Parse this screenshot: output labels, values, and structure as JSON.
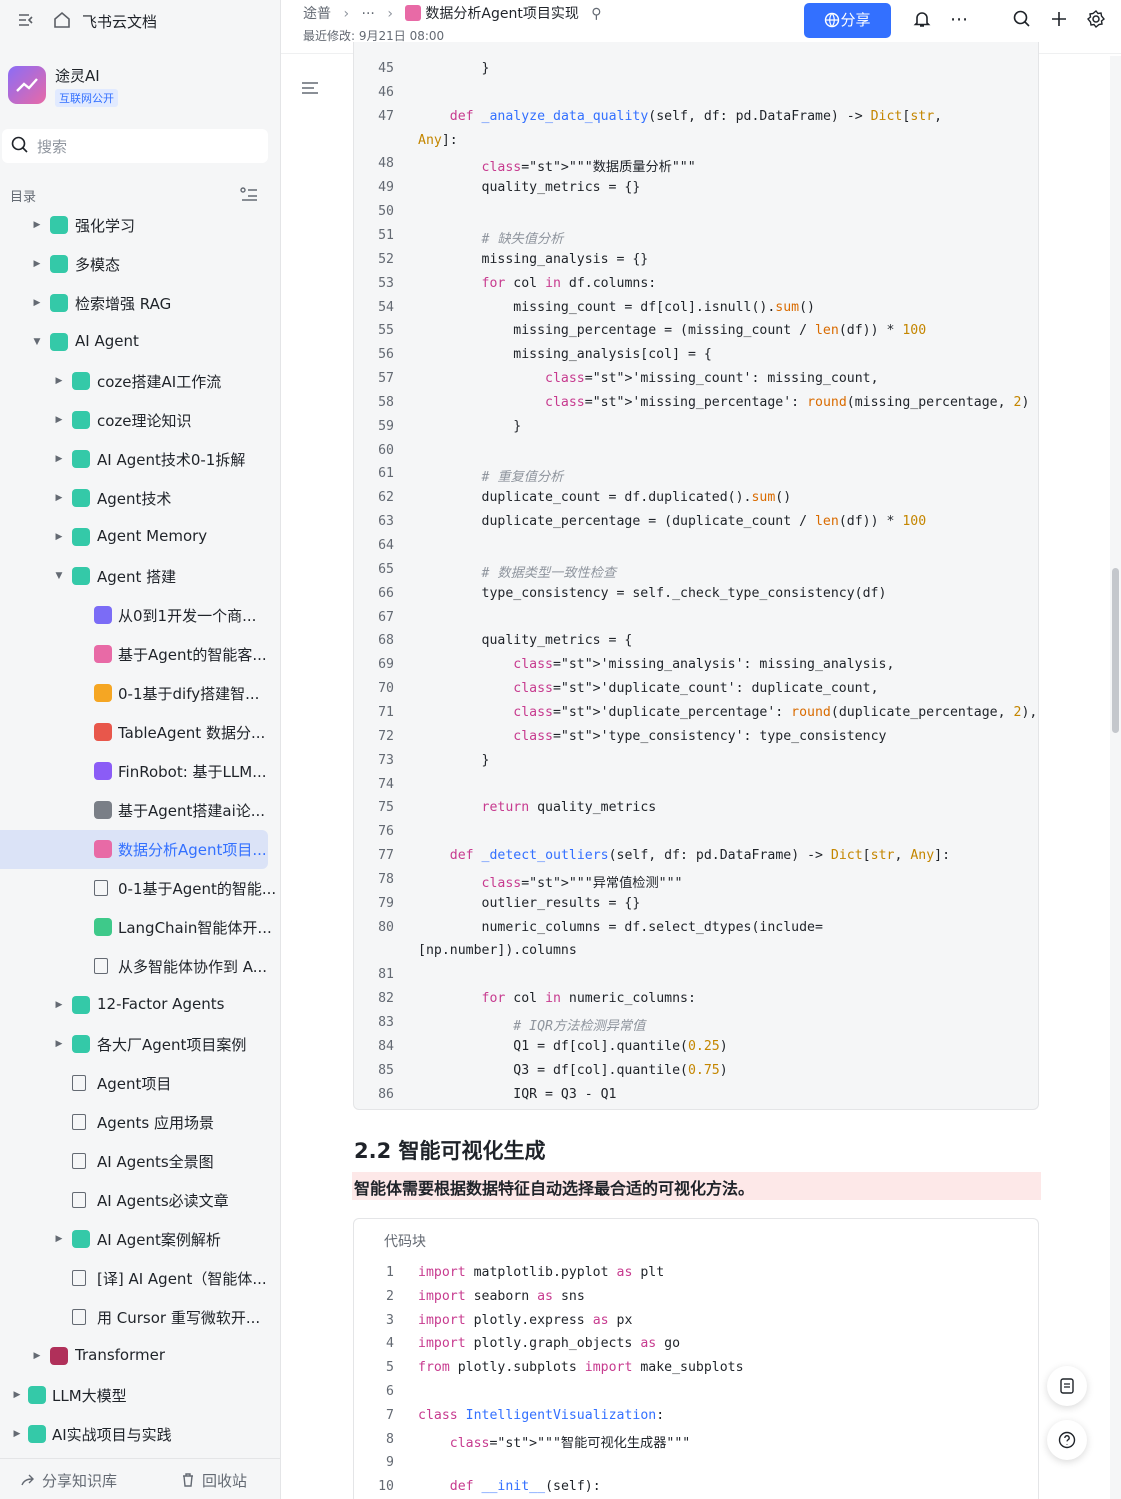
{
  "sidebar": {
    "brand": "飞书云文档",
    "space_name": "途灵AI",
    "space_tag": "互联网公开",
    "search_placeholder": "搜索",
    "toc_label": "目录",
    "items": [
      {
        "label": "强化学习",
        "level": 1,
        "caret": "right",
        "icon": "doc-green-icon"
      },
      {
        "label": "多模态",
        "level": 1,
        "caret": "right",
        "icon": "doc-green-icon"
      },
      {
        "label": "检索增强 RAG",
        "level": 1,
        "caret": "right",
        "icon": "doc-green-icon"
      },
      {
        "label": "AI Agent",
        "level": 1,
        "caret": "down",
        "icon": "doc-green-icon"
      },
      {
        "label": "coze搭建AI工作流",
        "level": 2,
        "caret": "right",
        "icon": "doc-green-icon"
      },
      {
        "label": "coze理论知识",
        "level": 2,
        "caret": "right",
        "icon": "doc-green-icon"
      },
      {
        "label": "AI Agent技术0-1拆解",
        "level": 2,
        "caret": "right",
        "icon": "doc-green-icon"
      },
      {
        "label": "Agent技术",
        "level": 2,
        "caret": "right",
        "icon": "doc-green-icon"
      },
      {
        "label": "Agent Memory",
        "level": 2,
        "caret": "right",
        "icon": "doc-green-icon"
      },
      {
        "label": "Agent 搭建",
        "level": 2,
        "caret": "down",
        "icon": "doc-green-icon"
      },
      {
        "label": "从0到1开发一个商...",
        "level": 3,
        "caret": "",
        "icon": "clock-purple-icon"
      },
      {
        "label": "基于Agent的智能客...",
        "level": 3,
        "caret": "",
        "icon": "pink-doc-icon"
      },
      {
        "label": "0-1基于dify搭建智...",
        "level": 3,
        "caret": "",
        "icon": "thumb-up-icon"
      },
      {
        "label": "TableAgent 数据分...",
        "level": 3,
        "caret": "",
        "icon": "rocket-icon"
      },
      {
        "label": "FinRobot: 基于LLM...",
        "level": 3,
        "caret": "",
        "icon": "robot-icon"
      },
      {
        "label": "基于Agent搭建ai论...",
        "level": 3,
        "caret": "",
        "icon": "tools-icon"
      },
      {
        "label": "数据分析Agent项目...",
        "level": 3,
        "caret": "",
        "icon": "pink-doc-icon",
        "selected": true
      },
      {
        "label": "0-1基于Agent的智能...",
        "level": 3,
        "caret": "",
        "icon": "doc-outline-icon"
      },
      {
        "label": "LangChain智能体开...",
        "level": 3,
        "caret": "",
        "icon": "green-circle-icon"
      },
      {
        "label": "从多智能体协作到 A...",
        "level": 3,
        "caret": "",
        "icon": "doc-outline-icon"
      },
      {
        "label": "12-Factor Agents",
        "level": 2,
        "caret": "right",
        "icon": "doc-green-icon"
      },
      {
        "label": "各大厂Agent项目案例",
        "level": 2,
        "caret": "right",
        "icon": "doc-green-icon"
      },
      {
        "label": "Agent项目",
        "level": 2,
        "caret": "",
        "icon": "board-icon"
      },
      {
        "label": "Agents 应用场景",
        "level": 2,
        "caret": "",
        "icon": "board-icon"
      },
      {
        "label": "AI Agents全景图",
        "level": 2,
        "caret": "",
        "icon": "board-icon"
      },
      {
        "label": "AI Agents必读文章",
        "level": 2,
        "caret": "",
        "icon": "board-icon"
      },
      {
        "label": "AI Agent案例解析",
        "level": 2,
        "caret": "right",
        "icon": "doc-green-icon"
      },
      {
        "label": "[译] AI Agent（智能体...",
        "level": 2,
        "caret": "",
        "icon": "doc-outline-icon"
      },
      {
        "label": "用 Cursor 重写微软开...",
        "level": 2,
        "caret": "",
        "icon": "doc-outline-icon"
      },
      {
        "label": "Transformer",
        "level": 1,
        "caret": "right",
        "icon": "film-icon"
      },
      {
        "label": "LLM大模型",
        "level": 0,
        "caret": "right",
        "icon": "doc-green-icon"
      },
      {
        "label": "AI实战项目与实践",
        "level": 0,
        "caret": "right",
        "icon": "doc-green-icon"
      }
    ],
    "share_kb": "分享知识库",
    "recycle": "回收站"
  },
  "header": {
    "breadcrumb": [
      "途普",
      "···",
      "数据分析Agent项目实现"
    ],
    "modified": "最近修改: 9月21日 08:00",
    "share_label": "分享"
  },
  "code1": {
    "lines": [
      {
        "n": "45",
        "t": "        }"
      },
      {
        "n": "46",
        "t": ""
      },
      {
        "n": "47",
        "t": "    def _analyze_data_quality(self, df: pd.DataFrame) -> Dict[str,"
      },
      {
        "n": "",
        "t": "Any]:"
      },
      {
        "n": "48",
        "t": "        \"\"\"数据质量分析\"\"\""
      },
      {
        "n": "49",
        "t": "        quality_metrics = {}"
      },
      {
        "n": "50",
        "t": ""
      },
      {
        "n": "51",
        "t": "        # 缺失值分析"
      },
      {
        "n": "52",
        "t": "        missing_analysis = {}"
      },
      {
        "n": "53",
        "t": "        for col in df.columns:"
      },
      {
        "n": "54",
        "t": "            missing_count = df[col].isnull().sum()"
      },
      {
        "n": "55",
        "t": "            missing_percentage = (missing_count / len(df)) * 100"
      },
      {
        "n": "56",
        "t": "            missing_analysis[col] = {"
      },
      {
        "n": "57",
        "t": "                'missing_count': missing_count,"
      },
      {
        "n": "58",
        "t": "                'missing_percentage': round(missing_percentage, 2)"
      },
      {
        "n": "59",
        "t": "            }"
      },
      {
        "n": "60",
        "t": ""
      },
      {
        "n": "61",
        "t": "        # 重复值分析"
      },
      {
        "n": "62",
        "t": "        duplicate_count = df.duplicated().sum()"
      },
      {
        "n": "63",
        "t": "        duplicate_percentage = (duplicate_count / len(df)) * 100"
      },
      {
        "n": "64",
        "t": ""
      },
      {
        "n": "65",
        "t": "        # 数据类型一致性检查"
      },
      {
        "n": "66",
        "t": "        type_consistency = self._check_type_consistency(df)"
      },
      {
        "n": "67",
        "t": ""
      },
      {
        "n": "68",
        "t": "        quality_metrics = {"
      },
      {
        "n": "69",
        "t": "            'missing_analysis': missing_analysis,"
      },
      {
        "n": "70",
        "t": "            'duplicate_count': duplicate_count,"
      },
      {
        "n": "71",
        "t": "            'duplicate_percentage': round(duplicate_percentage, 2),"
      },
      {
        "n": "72",
        "t": "            'type_consistency': type_consistency"
      },
      {
        "n": "73",
        "t": "        }"
      },
      {
        "n": "74",
        "t": ""
      },
      {
        "n": "75",
        "t": "        return quality_metrics"
      },
      {
        "n": "76",
        "t": ""
      },
      {
        "n": "77",
        "t": "    def _detect_outliers(self, df: pd.DataFrame) -> Dict[str, Any]:"
      },
      {
        "n": "78",
        "t": "        \"\"\"异常值检测\"\"\""
      },
      {
        "n": "79",
        "t": "        outlier_results = {}"
      },
      {
        "n": "80",
        "t": "        numeric_columns = df.select_dtypes(include="
      },
      {
        "n": "",
        "t": "[np.number]).columns"
      },
      {
        "n": "81",
        "t": ""
      },
      {
        "n": "82",
        "t": "        for col in numeric_columns:"
      },
      {
        "n": "83",
        "t": "            # IQR方法检测异常值"
      },
      {
        "n": "84",
        "t": "            Q1 = df[col].quantile(0.25)"
      },
      {
        "n": "85",
        "t": "            Q3 = df[col].quantile(0.75)"
      },
      {
        "n": "86",
        "t": "            IQR = Q3 - Q1"
      }
    ]
  },
  "section": {
    "heading": "2.2 智能可视化生成",
    "highlight": "智能体需要根据数据特征自动选择最合适的可视化方法。"
  },
  "code2": {
    "title": "代码块",
    "lines": [
      {
        "n": "1",
        "t": "import matplotlib.pyplot as plt"
      },
      {
        "n": "2",
        "t": "import seaborn as sns"
      },
      {
        "n": "3",
        "t": "import plotly.express as px"
      },
      {
        "n": "4",
        "t": "import plotly.graph_objects as go"
      },
      {
        "n": "5",
        "t": "from plotly.subplots import make_subplots"
      },
      {
        "n": "6",
        "t": ""
      },
      {
        "n": "7",
        "t": "class IntelligentVisualization:"
      },
      {
        "n": "8",
        "t": "    \"\"\"智能可视化生成器\"\"\""
      },
      {
        "n": "9",
        "t": ""
      },
      {
        "n": "10",
        "t": "    def __init__(self):"
      }
    ]
  },
  "colors": {
    "accent": "#3370ff",
    "selected_bg": "#dbe3f7",
    "highlight_bg": "#fde8e8"
  }
}
